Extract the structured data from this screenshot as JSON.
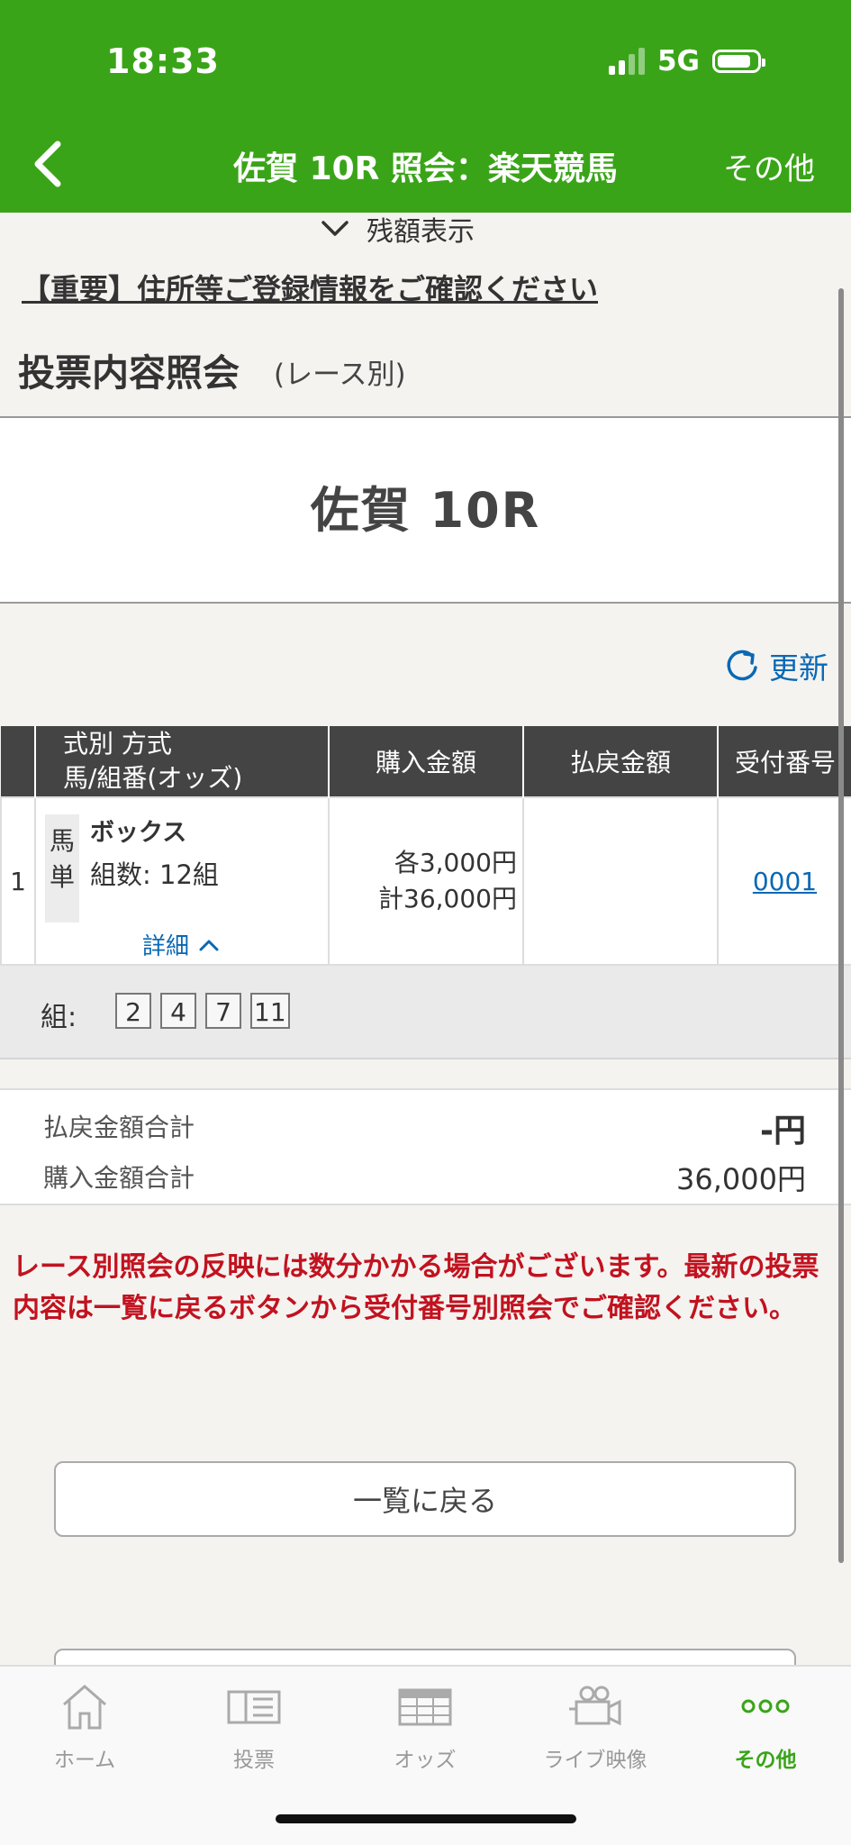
{
  "status": {
    "time": "18:33",
    "network": "5G"
  },
  "nav": {
    "title": "佐賀 10R 照会：楽天競馬",
    "more": "その他"
  },
  "balance_toggle": "残額表示",
  "notice_link": "【重要】住所等ご登録情報をご確認ください",
  "section": {
    "title": "投票内容照会",
    "subtitle": "(レース別)"
  },
  "race_name": "佐賀 10R",
  "refresh_label": "更新",
  "table": {
    "headers": {
      "type_line1": "式別 方式",
      "type_line2": "馬/組番(オッズ)",
      "purchase": "購入金額",
      "payout": "払戻金額",
      "receipt": "受付番号"
    },
    "rows": [
      {
        "index": "1",
        "kind_line1": "馬",
        "kind_line2": "単",
        "method": "ボックス",
        "count": "組数: 12組",
        "detail": "詳細",
        "amount_each": "各3,000円",
        "amount_total": "計36,000円",
        "payout": "",
        "receipt": "0001"
      }
    ],
    "combo": {
      "label": "組:",
      "numbers": [
        "2",
        "4",
        "7",
        "11"
      ]
    }
  },
  "totals": {
    "payout_label": "払戻金額合計",
    "payout_value": "-円",
    "purchase_label": "購入金額合計",
    "purchase_value": "36,000円"
  },
  "warning": "レース別照会の反映には数分かかる場合がございます。最新の投票内容は一覧に戻るボタンから受付番号別照会でご確認ください。",
  "back_button": "一覧に戻る",
  "tabs": [
    {
      "label": "ホーム",
      "icon": "home-icon"
    },
    {
      "label": "投票",
      "icon": "ticket-icon"
    },
    {
      "label": "オッズ",
      "icon": "odds-table-icon"
    },
    {
      "label": "ライブ映像",
      "icon": "video-camera-icon"
    },
    {
      "label": "その他",
      "icon": "more-dots-icon"
    }
  ],
  "colors": {
    "brand_green": "#3aa418",
    "link_blue": "#0a68b4",
    "warning_red": "#c2121f",
    "header_dark": "#444444"
  }
}
